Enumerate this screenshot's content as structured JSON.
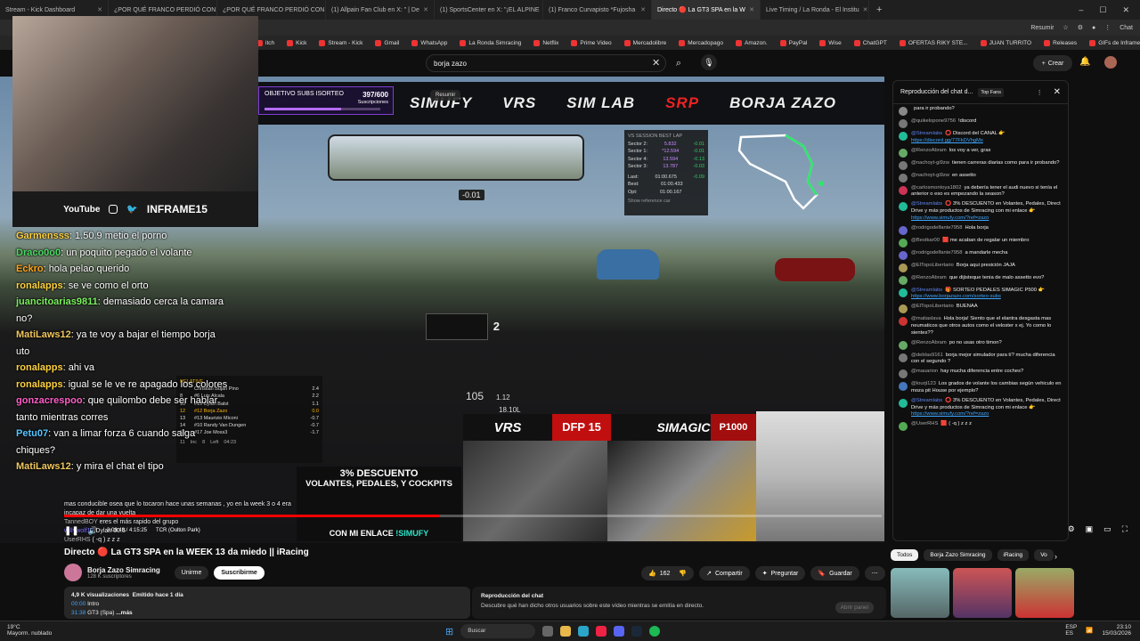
{
  "browser": {
    "tabs": [
      {
        "label": "Stream - Kick Dashboard",
        "active": false
      },
      {
        "label": "¿POR QUÉ FRANCO PERDIÓ CON",
        "active": false
      },
      {
        "label": "¿POR QUÉ FRANCO PERDIÓ CON",
        "active": false
      },
      {
        "label": "(1) Allpain Fan Club en X: \" | De",
        "active": false
      },
      {
        "label": "(1) SportsCenter en X: \"¡EL ALPINE",
        "active": false
      },
      {
        "label": "(1) Franco Curvapisto *Fujosha",
        "active": false
      },
      {
        "label": "Directo 🔴 La GT3 SPA en la W",
        "active": true
      },
      {
        "label": "Live Timing / La Ronda - El Institu",
        "active": false
      }
    ],
    "new_tab": "+",
    "resumir": "Resumir",
    "bookmarks": [
      "itch",
      "Kick",
      "Stream - Kick",
      "Gmail",
      "WhatsApp",
      "La Ronda Simracing",
      "Netflix",
      "Prime Video",
      "Mercadolibre",
      "Mercadopago",
      "Amazon.",
      "PayPal",
      "Wise",
      "ChatGPT",
      "OFERTAS RIKY STE...",
      "JUAN TURRITO",
      "Releases",
      "GIFs de Inframe | T...",
      "CRIPTO"
    ],
    "chat_label": "Chat"
  },
  "youtube": {
    "search_value": "borja zazo",
    "create_label": "Crear",
    "video_title": "Directo 🔴 La GT3 SPA en la WEEK 13 da miedo || iRacing",
    "channel_name": "Borja Zazo Simracing",
    "subscribers": "128 K suscriptores",
    "unirme": "Unirme",
    "subscribe": "Suscribirme",
    "likes": "162",
    "share": "Compartir",
    "ask": "Preguntar",
    "save": "Guardar",
    "views": "4,9 K visualizaciones",
    "emitted": "Emitido hace 1 día",
    "chapter1_time": "00:00",
    "chapter1": "Intro",
    "chapter2_time": "31:38",
    "chapter2": "GT3 (Spa)",
    "more": "...más",
    "chat_replay_title": "Reproducción del chat",
    "chat_replay_desc": "Descubre qué han dicho otros usuarios sobre este vídeo mientras se emitía en directo.",
    "open_panel": "Abrir panel",
    "player": {
      "time": "3:08:48 / 4:15:25",
      "chapter": "TCR (Oulton Park)",
      "progress": 0.46
    },
    "chips": [
      "Todos",
      "Borja Zazo Simracing",
      "iRacing",
      "Vo"
    ]
  },
  "overlay": {
    "subs_goal_label": "OBJETIVO SUBS ISORTEO",
    "subs_count": "397/600",
    "subs_sub": "Suscripciones",
    "subs_progress": 0.66,
    "sponsors": [
      "SIMUFY",
      "VRS",
      "SIM LAB",
      "SRP",
      "BORJA ZAZO"
    ],
    "delta": "-0.01",
    "social_handle": "INFRAME15",
    "social_yt": "YouTube",
    "dash_number": "2",
    "speed": "105",
    "speed_right": "1.12",
    "ladder_val": "18.10L",
    "brand_vrs": "VRS",
    "brand_dfp": "DFP 15",
    "brand_simagic": "SIMAGIC",
    "brand_p1000": "P1000",
    "promo_pct": "3% DESCUENTO",
    "promo_items": "VOLANTES, PEDALES, Y COCKPITS",
    "promo_code_pre": "CON MI ENLACE",
    "promo_code": "!SIMUFY",
    "splits": {
      "title": "VS SESSION BEST LAP",
      "rows": [
        {
          "label": "Sector 2:",
          "time": "5.832",
          "delta": "-0.01"
        },
        {
          "label": "Sector 1:",
          "time": "*12.594",
          "delta": "-0.01"
        },
        {
          "label": "Sector 4:",
          "time": "13.594",
          "delta": "-0.13"
        },
        {
          "label": "Sector 3:",
          "time": "13.787",
          "delta": "-0.03"
        }
      ],
      "last_label": "Last:",
      "last": "01:00.675",
      "last_d": "-0.09",
      "best_label": "Best:",
      "best": "01:00.433",
      "opt_label": "Opt:",
      "opt": "01:00.167",
      "show_ref": "Show reference car"
    },
    "relative": {
      "title": "RELATIVE",
      "rows": [
        {
          "pos": "",
          "name": "Christian Buján Pino",
          "gap": "2.4"
        },
        {
          "pos": "8",
          "name": "#6 Luis Alcala",
          "gap": "2.2"
        },
        {
          "pos": "10",
          "name": "#15 Dylan Balst",
          "gap": "1.1"
        },
        {
          "pos": "12",
          "name": "#12 Borja Zazo",
          "gap": "0.0"
        },
        {
          "pos": "13",
          "name": "#13 Maurizio Miconi",
          "gap": "-0.7"
        },
        {
          "pos": "14",
          "name": "#10 Randy Van Dungen",
          "gap": "-0.7"
        },
        {
          "pos": "16",
          "name": "#17 Joe Moss3",
          "gap": "-1.7"
        }
      ],
      "foot1": "11",
      "foot2": "Inc",
      "foot3": "8",
      "foot4": "Left",
      "foot5": "04:23"
    }
  },
  "stream_chat": [
    {
      "user": "Garmensss",
      "color": "#ffd23f",
      "text": ": 1.50.9 metio el porno"
    },
    {
      "user": "Draco0o0",
      "color": "#4cd964",
      "text": ": un poquito pegado el volante"
    },
    {
      "user": "Eckro",
      "color": "#ffa51a",
      "text": ": hola pelao querido"
    },
    {
      "user": "ronalapps",
      "color": "#ffd23f",
      "text": ": se ve como el orto"
    },
    {
      "user": "juancitoarias9811",
      "color": "#7cf25e",
      "text": ": demasiado cerca la camara no?"
    },
    {
      "user": "MatiLaws12",
      "color": "#f0c75e",
      "text": ": ya te voy a bajar el tiempo borja uto"
    },
    {
      "user": "ronalapps",
      "color": "#ffd23f",
      "text": ": ahi va"
    },
    {
      "user": "ronalapps",
      "color": "#ffd23f",
      "text": ": igual se le ve re apagado los colores"
    },
    {
      "user": "gonzacrespoo",
      "color": "#ff5ec8",
      "text": ": que quilombo debe ser hablar tanto mientras corres"
    },
    {
      "user": "Petu07",
      "color": "#56c5ff",
      "text": ": van a limar forza 6 cuando salga chiques?"
    },
    {
      "user": "MatiLaws12",
      "color": "#f0c75e",
      "text": ": y mira el chat el tipo"
    }
  ],
  "now_playing": [
    {
      "user": "",
      "text": "mas conducible osea que lo tocaron hace unas semanas , yo en la week 3 o 4 era incapaz de dar una vuelta"
    },
    {
      "user": "TannedBOY",
      "text": "eres el más rapido del grupo"
    },
    {
      "user": "willywolf15",
      "text": "Dylan 00.5"
    },
    {
      "user": "UserRHS",
      "text": "( -q ) z z z"
    }
  ],
  "live_chat": {
    "header": "Reproducción del chat d...",
    "top_fans": "Top Fans",
    "messages": [
      {
        "user": "",
        "text": "para ir probando?",
        "avatar": "#888"
      },
      {
        "user": "@quikelopone9756",
        "text": "!discord",
        "avatar": "#777"
      },
      {
        "user": "@Streamlabs",
        "mod": true,
        "text": "⭕ Discord del CANAL 👉 ",
        "link": "https://discord.gg/77FkDVhgMx",
        "avatar": "#2b9"
      },
      {
        "user": "@RenzoAbram",
        "text": "los voy a ver, grax",
        "avatar": "#6a6"
      },
      {
        "user": "@nachoyt-gi9zw",
        "text": "tienen carreras diarias como para ir probando?",
        "avatar": "#777"
      },
      {
        "user": "@nachoyt-gi9zw",
        "text": "en assetto",
        "avatar": "#777"
      },
      {
        "user": "@carlosmontoya1802",
        "text": "ya debería tener el audi nuevo si tenía el anterior o eso es empezando la season?",
        "avatar": "#c35"
      },
      {
        "user": "@Streamlabs",
        "mod": true,
        "text": "⭕ 3% DESCUENTO en Volantes, Pedales, Direct Drive y más productos de Simracing con mi enlace 👉 ",
        "link": "https://www.simufy.com/?ref=zazo",
        "avatar": "#2b9"
      },
      {
        "user": "@rodrigodelfante7958",
        "text": "Hola borja",
        "avatar": "#66c"
      },
      {
        "user": "@Bestkar00",
        "text": "🟥 me acaban de regalar un miembro",
        "avatar": "#5a5"
      },
      {
        "user": "@rodrigodelfante7958",
        "text": "a mandarle mecha",
        "avatar": "#66c"
      },
      {
        "user": "@ElTopoLibertario",
        "text": "Borja aqui presición JAJA",
        "avatar": "#a95"
      },
      {
        "user": "@RenzoAbram",
        "text": "que dijisteque tenia de malo assetto evo?",
        "avatar": "#6a6"
      },
      {
        "user": "@Streamlabs",
        "mod": true,
        "text": "🎁 SORTEO PEDALES SIMAGIC P500 👉 ",
        "link": "https://www.borjazazo.com/sorteo-subs",
        "avatar": "#2b9"
      },
      {
        "user": "@ElTopoLibertario",
        "text": "BUENAA",
        "avatar": "#a95"
      },
      {
        "user": "@matiaslava",
        "text": "Hola borja! Siento que el elantra desgasta mas neumaticos que otros autos como el veloster x ej. Yo como lo sientes??",
        "avatar": "#c33"
      },
      {
        "user": "@RenzoAbram",
        "text": "po no usas otro timon?",
        "avatar": "#6a6"
      },
      {
        "user": "@deblas9161",
        "text": "borja mejor simulador para tí? mucha diferencia con el segundo ?",
        "avatar": "#777"
      },
      {
        "user": "@mauarion",
        "text": "hay mucha diferencia entre coches?",
        "avatar": "#777"
      },
      {
        "user": "@lourji123",
        "text": "Los grados de volante los cambias según vehiculo en moza pit House por ejemplo?",
        "avatar": "#47b"
      },
      {
        "user": "@Streamlabs",
        "mod": true,
        "text": "⭕ 3% DESCUENTO en Volantes, Pedales, Direct Drive y más productos de Simracing con mi enlace 👉 ",
        "link": "https://www.simufy.com/?ref=zazo",
        "avatar": "#2b9"
      },
      {
        "user": "@UserRHS",
        "text": "🟥 ( -q ) z z z",
        "avatar": "#5a5"
      }
    ]
  },
  "taskbar": {
    "temp": "19°C",
    "weather": "Mayorm. nublado",
    "search": "Buscar",
    "lang1": "ESP",
    "lang2": "ES",
    "time": "23:10",
    "date": "15/03/2026"
  },
  "colors": {
    "accent": "#ff0000",
    "link": "#3ea6ff",
    "purple": "#7d3fd1",
    "teal": "#2ee6c9"
  }
}
